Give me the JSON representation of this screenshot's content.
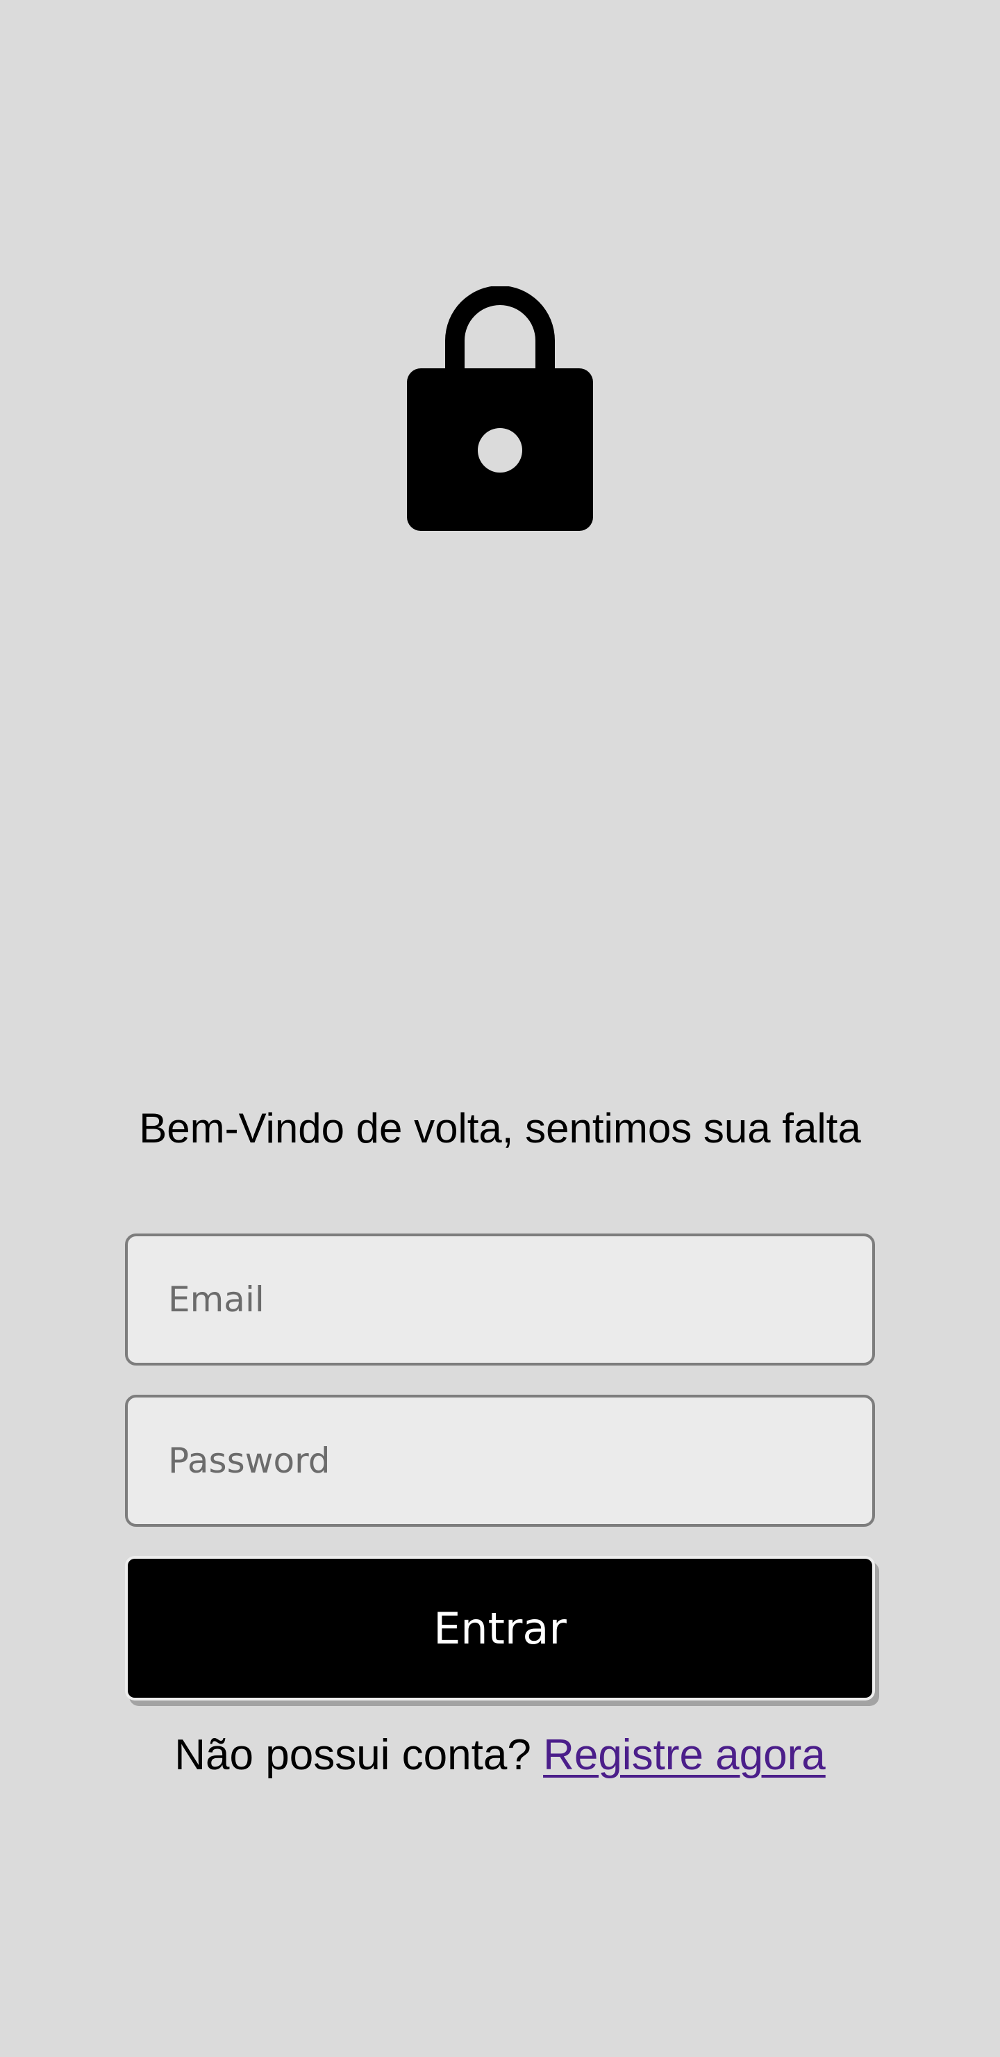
{
  "icons": {
    "lock": "lock-icon"
  },
  "welcome": {
    "text": "Bem-Vindo de volta, sentimos sua falta"
  },
  "form": {
    "email_placeholder": "Email",
    "password_placeholder": "Password",
    "login_label": "Entrar"
  },
  "register": {
    "prompt": "Não possui conta? ",
    "link_label": "Registre agora"
  },
  "colors": {
    "background": "#dbdbdb",
    "field_background": "#ebebeb",
    "field_border": "#7d7d7d",
    "button": "#000000",
    "button_text": "#ffffff",
    "link": "#4b1e8a"
  }
}
